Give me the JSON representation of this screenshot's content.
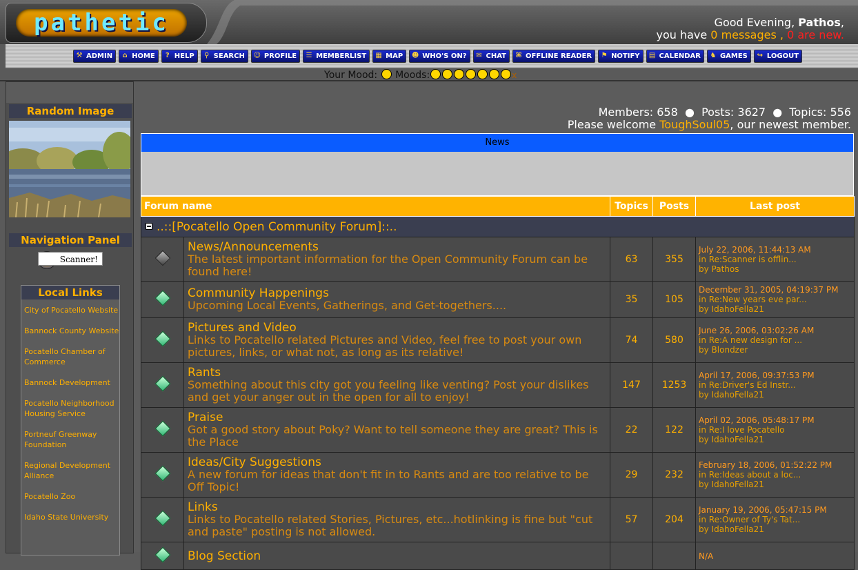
{
  "header": {
    "logo_text": "pathetic",
    "greeting_prefix": "Good Evening, ",
    "user_name": "Pathos",
    "greeting_suffix": ",",
    "msg_prefix": "you have ",
    "msg_count": "0 messages",
    "msg_sep": " , ",
    "msg_new": "0 are new."
  },
  "nav": {
    "items": [
      {
        "label": "ADMIN",
        "icon": "wrench-icon"
      },
      {
        "label": "HOME",
        "icon": "home-icon"
      },
      {
        "label": "HELP",
        "icon": "help-icon"
      },
      {
        "label": "SEARCH",
        "icon": "search-icon"
      },
      {
        "label": "PROFILE",
        "icon": "profile-icon"
      },
      {
        "label": "MEMBERLIST",
        "icon": "memberlist-icon"
      },
      {
        "label": "MAP",
        "icon": "map-icon"
      },
      {
        "label": "WHO'S ON?",
        "icon": "whos-on-icon"
      },
      {
        "label": "CHAT",
        "icon": "chat-icon"
      },
      {
        "label": "OFFLINE READER",
        "icon": "offline-reader-icon"
      },
      {
        "label": "NOTIFY",
        "icon": "notify-icon"
      },
      {
        "label": "CALENDAR",
        "icon": "calendar-icon"
      },
      {
        "label": "GAMES",
        "icon": "games-icon"
      },
      {
        "label": "LOGOUT",
        "icon": "logout-icon"
      }
    ]
  },
  "mood": {
    "your_mood_label": "Your Mood:",
    "moods_label": "Moods:",
    "clear": "x"
  },
  "sidebar": {
    "random_image_title": "Random Image",
    "nav_panel_title": "Navigation Panel",
    "scanner_label": "Scanner!",
    "local_links_title": "Local Links",
    "local_links": [
      "City of Pocatello Website",
      "Bannock County Website",
      "Pocatello Chamber of Commerce",
      "Bannock Development",
      "Pocatello Neighborhood Housing Service",
      "Portneuf Greenway Foundation",
      "Regional Development Alliance",
      "Pocatello Zoo",
      "Idaho State University"
    ]
  },
  "stats": {
    "line1": "Members: 658  ●  Posts: 3627  ●  Topics: 556",
    "welcome_prefix": "Please welcome ",
    "newest_member": "ToughSoul05",
    "welcome_suffix": ", our newest member."
  },
  "news": {
    "title": "News"
  },
  "forum_table": {
    "headers": {
      "name": "Forum name",
      "topics": "Topics",
      "posts": "Posts",
      "last": "Last post"
    },
    "category": "..::[Pocatello Open Community Forum]::..",
    "rows": [
      {
        "name": "News/Announcements",
        "desc": "The latest important information for the Open Community Forum can be found here!",
        "topics": "63",
        "posts": "355",
        "date": "July 22, 2006, 11:44:13 AM",
        "re": "in Re:Scanner is offlin...",
        "by": "by Pathos",
        "icon": "grey"
      },
      {
        "name": "Community Happenings",
        "desc": "Upcoming Local Events, Gatherings, and Get-togethers....",
        "topics": "35",
        "posts": "105",
        "date": "December 31, 2005, 04:19:37 PM",
        "re": "in Re:New years eve par...",
        "by": "by IdahoFella21",
        "icon": "green"
      },
      {
        "name": "Pictures and Video",
        "desc": "Links to Pocatello related Pictures and Video, feel free to post your own pictures, links, or what not, as long as its relative!",
        "topics": "74",
        "posts": "580",
        "date": "June 26, 2006, 03:02:26 AM",
        "re": "in Re:A new design for ...",
        "by": "by Blondzer",
        "icon": "green"
      },
      {
        "name": "Rants",
        "desc": "Something about this city got you feeling like venting? Post your dislikes and get your anger out in the open for all to enjoy!",
        "topics": "147",
        "posts": "1253",
        "date": "April 17, 2006, 09:37:53 PM",
        "re": "in Re:Driver's Ed Instr...",
        "by": "by IdahoFella21",
        "icon": "green"
      },
      {
        "name": "Praise",
        "desc": "Got a good story about Poky? Want to tell someone they are great? This is the Place",
        "topics": "22",
        "posts": "122",
        "date": "April 02, 2006, 05:48:17 PM",
        "re": "in Re:I love Pocatello",
        "by": "by IdahoFella21",
        "icon": "green"
      },
      {
        "name": "Ideas/City Suggestions",
        "desc": "A new forum for ideas that don't fit in to Rants and are too relative to be Off Topic!",
        "topics": "29",
        "posts": "232",
        "date": "February 18, 2006, 01:52:22 PM",
        "re": "in Re:Ideas about a loc...",
        "by": "by IdahoFella21",
        "icon": "green"
      },
      {
        "name": "Links",
        "desc": "Links to Pocatello related Stories, Pictures, etc...hotlinking is fine but \"cut and paste\" posting is not allowed.",
        "topics": "57",
        "posts": "204",
        "date": "January 19, 2006, 05:47:15 PM",
        "re": "in Re:Owner of Ty's Tat...",
        "by": "by IdahoFella21",
        "icon": "green"
      },
      {
        "name": "Blog Section",
        "desc": "",
        "topics": "",
        "posts": "",
        "date": "N/A",
        "re": "",
        "by": "",
        "icon": "green"
      }
    ]
  }
}
